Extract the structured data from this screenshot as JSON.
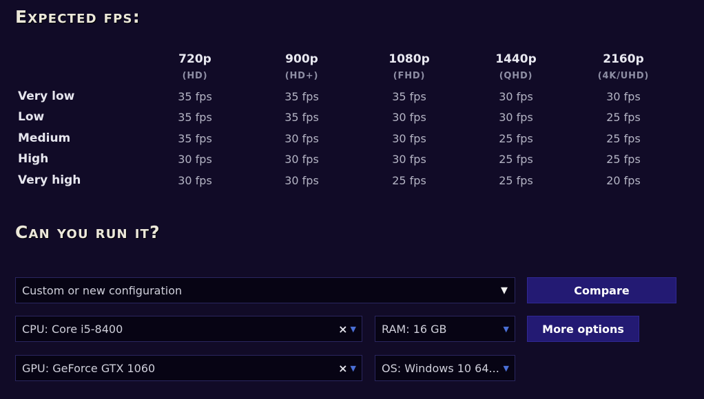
{
  "fps_section": {
    "heading": "Expected fps:",
    "resolutions": [
      {
        "label": "720p",
        "sub": "(HD)"
      },
      {
        "label": "900p",
        "sub": "(HD+)"
      },
      {
        "label": "1080p",
        "sub": "(FHD)"
      },
      {
        "label": "1440p",
        "sub": "(QHD)"
      },
      {
        "label": "2160p",
        "sub": "(4K/UHD)"
      }
    ],
    "rows": [
      {
        "label": "Very low",
        "values": [
          "35 fps",
          "35 fps",
          "35 fps",
          "30 fps",
          "30 fps"
        ]
      },
      {
        "label": "Low",
        "values": [
          "35 fps",
          "35 fps",
          "30 fps",
          "30 fps",
          "25 fps"
        ]
      },
      {
        "label": "Medium",
        "values": [
          "35 fps",
          "30 fps",
          "30 fps",
          "25 fps",
          "25 fps"
        ]
      },
      {
        "label": "High",
        "values": [
          "30 fps",
          "30 fps",
          "30 fps",
          "25 fps",
          "25 fps"
        ]
      },
      {
        "label": "Very high",
        "values": [
          "30 fps",
          "30 fps",
          "25 fps",
          "25 fps",
          "20 fps"
        ]
      }
    ]
  },
  "run_section": {
    "heading": "Can you run it?",
    "config_select": "Custom or new configuration",
    "cpu_select": "CPU: Core i5-8400",
    "gpu_select": "GPU: GeForce GTX 1060",
    "ram_select": "RAM: 16 GB",
    "os_select": "OS: Windows 10 64...",
    "compare_button": "Compare",
    "more_options_button": "More options",
    "clear_symbol": "×",
    "dropdown_arrow": "▼"
  },
  "colors": {
    "background": "#110b27",
    "field_background": "#070414",
    "button": "#231a73",
    "arrow_accent": "#4a6fd6"
  },
  "icons": [
    "clear-x-icon",
    "dropdown-arrow-icon"
  ]
}
